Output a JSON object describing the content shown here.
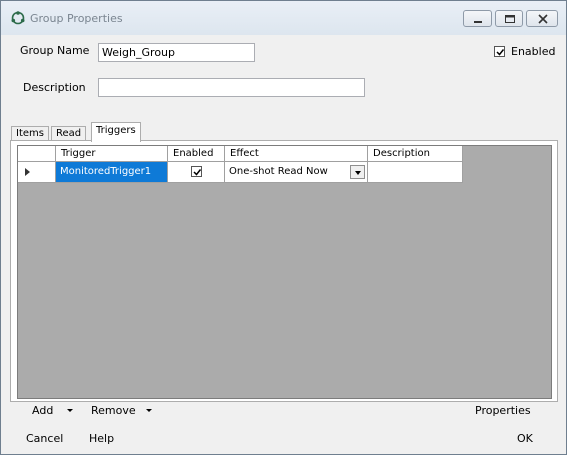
{
  "window": {
    "title": "Group Properties"
  },
  "form": {
    "group_name_label": "Group Name",
    "group_name_value": "Weigh_Group",
    "description_label": "Description",
    "description_value": "",
    "enabled_label": "Enabled",
    "enabled_checked": true
  },
  "tabs": [
    {
      "label": "Items",
      "active": false
    },
    {
      "label": "Read",
      "active": false
    },
    {
      "label": "Triggers",
      "active": true
    }
  ],
  "grid": {
    "columns": [
      "Trigger",
      "Enabled",
      "Effect",
      "Description"
    ],
    "rows": [
      {
        "trigger": "MonitoredTrigger1",
        "enabled": true,
        "effect": "One-shot Read Now",
        "description": "",
        "selected": true
      }
    ]
  },
  "panel_buttons": {
    "add": "Add",
    "remove": "Remove",
    "properties": "Properties"
  },
  "footer": {
    "cancel": "Cancel",
    "help": "Help",
    "ok": "OK"
  },
  "colors": {
    "selection": "#0e7ad7",
    "grid_background": "#ababab",
    "dialog_background": "#f0f0f0"
  }
}
